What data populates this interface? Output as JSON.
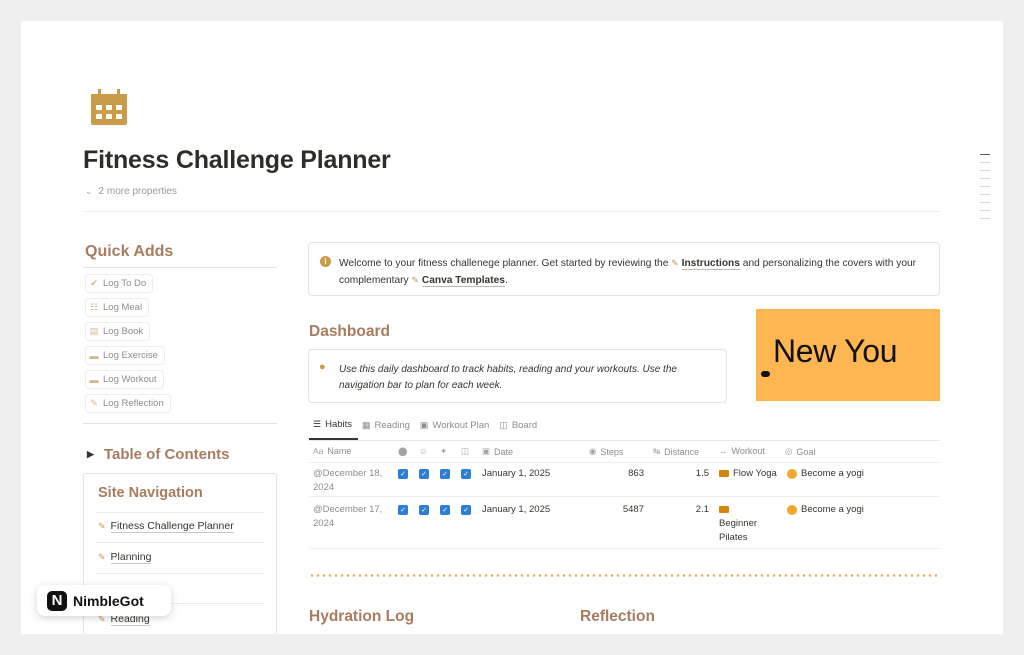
{
  "page": {
    "title": "Fitness Challenge Planner",
    "more_properties": "2 more properties"
  },
  "quick_adds": {
    "title": "Quick Adds",
    "items": [
      {
        "label": "Log To Do",
        "icon": "check-circle-icon"
      },
      {
        "label": "Log Meal",
        "icon": "meal-icon"
      },
      {
        "label": "Log Book",
        "icon": "book-icon"
      },
      {
        "label": "Log Exercise",
        "icon": "dumbbell-icon"
      },
      {
        "label": "Log Workout",
        "icon": "dumbbell-icon"
      },
      {
        "label": "Log Reflection",
        "icon": "reflection-icon"
      }
    ]
  },
  "toc": {
    "title": "Table of Contents",
    "site_nav_title": "Site Navigation",
    "links": [
      "Fitness Challenge Planner",
      "Planning",
      "Reading"
    ]
  },
  "callout": {
    "text_1": "Welcome to your fitness challenege planner. Get started by reviewing the",
    "link_1": "Instructions",
    "text_2": "and personalizing the covers with your complementary",
    "link_2": "Canva Templates",
    "text_3": "."
  },
  "dashboard": {
    "title": "Dashboard",
    "tip": "Use this daily dashboard to track habits, reading and your workouts. Use the navigation bar to plan for each week.",
    "cover_text": "New You"
  },
  "tabs": [
    "Habits",
    "Reading",
    "Workout Plan",
    "Board"
  ],
  "table": {
    "headers": {
      "name": "Name",
      "date": "Date",
      "steps": "Steps",
      "distance": "Distance",
      "workout": "Workout",
      "goal": "Goal"
    },
    "rows": [
      {
        "name": "@December 18, 2024",
        "date": "January 1, 2025",
        "steps": "863",
        "distance": "1.5",
        "workout": "Flow Yoga",
        "goal": "Become a yogi"
      },
      {
        "name": "@December 17, 2024",
        "date": "January 1, 2025",
        "steps": "5487",
        "distance": "2.1",
        "workout": "Beginner Pilates",
        "goal": "Become a yogi"
      }
    ]
  },
  "sections": {
    "hydration": "Hydration Log",
    "reflection": "Reflection"
  },
  "watermark": {
    "brand": "NimbleGot",
    "logo_letter": "N"
  },
  "colors": {
    "accent": "#a87c5f",
    "cover": "#fdb652",
    "checkbox": "#2e7fd4",
    "icon_gold": "#c99b4b"
  }
}
